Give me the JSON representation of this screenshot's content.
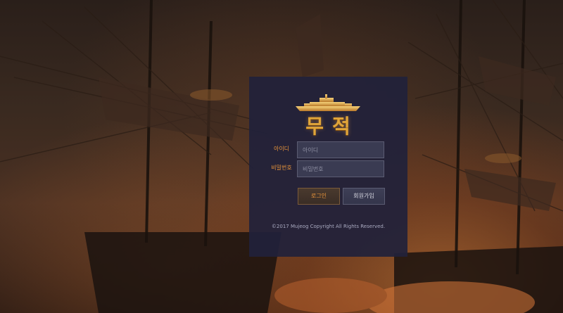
{
  "brand": {
    "logo_text": "무적",
    "logo_icon": "battleship-icon"
  },
  "login_form": {
    "id_label": "아이디",
    "id_placeholder": "아이디",
    "password_label": "비밀번호",
    "password_placeholder": "비밀번호",
    "login_button": "로그인",
    "signup_button": "회원가입"
  },
  "footer": {
    "copyright": "©2017 Mujeog Copyright All Rights Reserved."
  },
  "colors": {
    "panel_background": "#21213a",
    "accent_label": "#e8943a",
    "logo_gold": "#e0a53a",
    "input_background": "#3a3b52",
    "input_border": "#5b5c72"
  },
  "background": {
    "scene": "pirate-ships-battle-background"
  }
}
